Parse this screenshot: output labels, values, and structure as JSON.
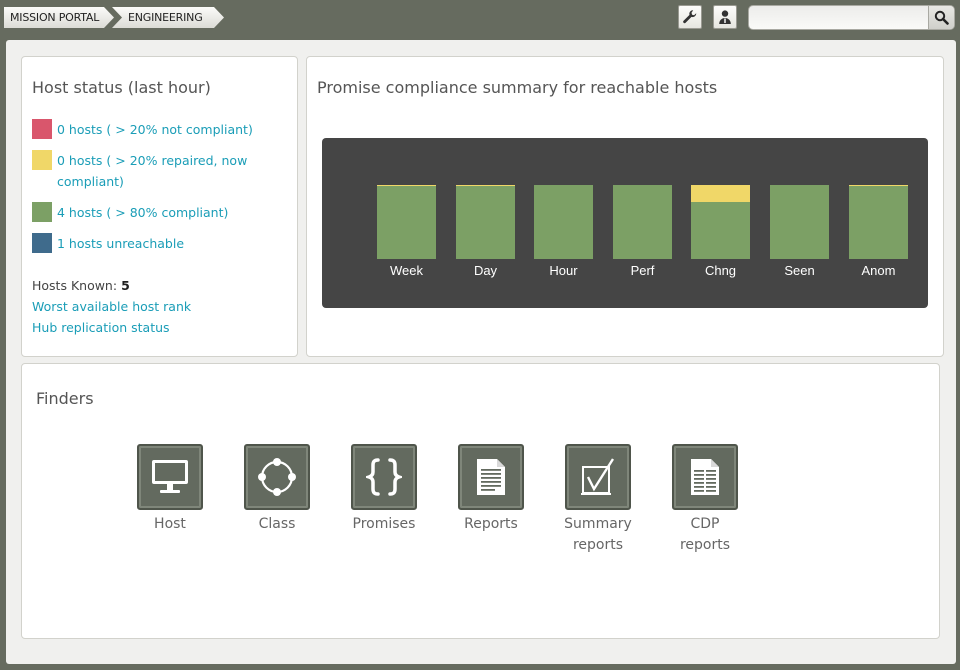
{
  "breadcrumbs": [
    "MISSION PORTAL",
    "ENGINEERING"
  ],
  "search": {
    "value": "",
    "placeholder": ""
  },
  "icons": {
    "settings": "wrench-icon",
    "user": "user-icon",
    "search": "magnifier-icon"
  },
  "host_status": {
    "title": "Host status (last hour)",
    "legend": [
      {
        "label": "0 hosts ( > 20% not compliant)",
        "color": "#d9566c"
      },
      {
        "label": "0 hosts ( > 20% repaired, now compliant)",
        "color": "#f0d768"
      },
      {
        "label": "4 hosts ( > 80% compliant)",
        "color": "#7ca065"
      },
      {
        "label": "1 hosts unreachable",
        "color": "#3f6b8c"
      }
    ],
    "known_label": "Hosts Known:",
    "known_value": "5",
    "links": [
      "Worst available host rank",
      "Hub replication status"
    ]
  },
  "compliance": {
    "title": "Promise compliance summary for reachable hosts",
    "colors": {
      "compliant": "#7ca065",
      "repaired": "#f0d768",
      "background": "#454545"
    }
  },
  "chart_data": {
    "type": "bar",
    "stacked": true,
    "categories": [
      "Week",
      "Day",
      "Hour",
      "Perf",
      "Chng",
      "Seen",
      "Anom"
    ],
    "series": [
      {
        "values": [
          98.5,
          99,
          100,
          100,
          77,
          100,
          99
        ],
        "color": "#7ca065"
      },
      {
        "values": [
          1.5,
          1,
          0,
          0,
          23,
          0,
          1
        ],
        "color": "#f0d768"
      }
    ],
    "ylim": [
      0,
      100
    ],
    "grid": false
  },
  "finders": {
    "title": "Finders",
    "items": [
      {
        "label": "Host",
        "icon": "monitor-icon"
      },
      {
        "label": "Class",
        "icon": "class-circle-icon"
      },
      {
        "label": "Promises",
        "icon": "braces-icon"
      },
      {
        "label": "Reports",
        "icon": "document-icon"
      },
      {
        "label": "Summary reports",
        "icon": "checkbox-document-icon"
      },
      {
        "label": "CDP reports",
        "icon": "table-document-icon"
      }
    ]
  }
}
